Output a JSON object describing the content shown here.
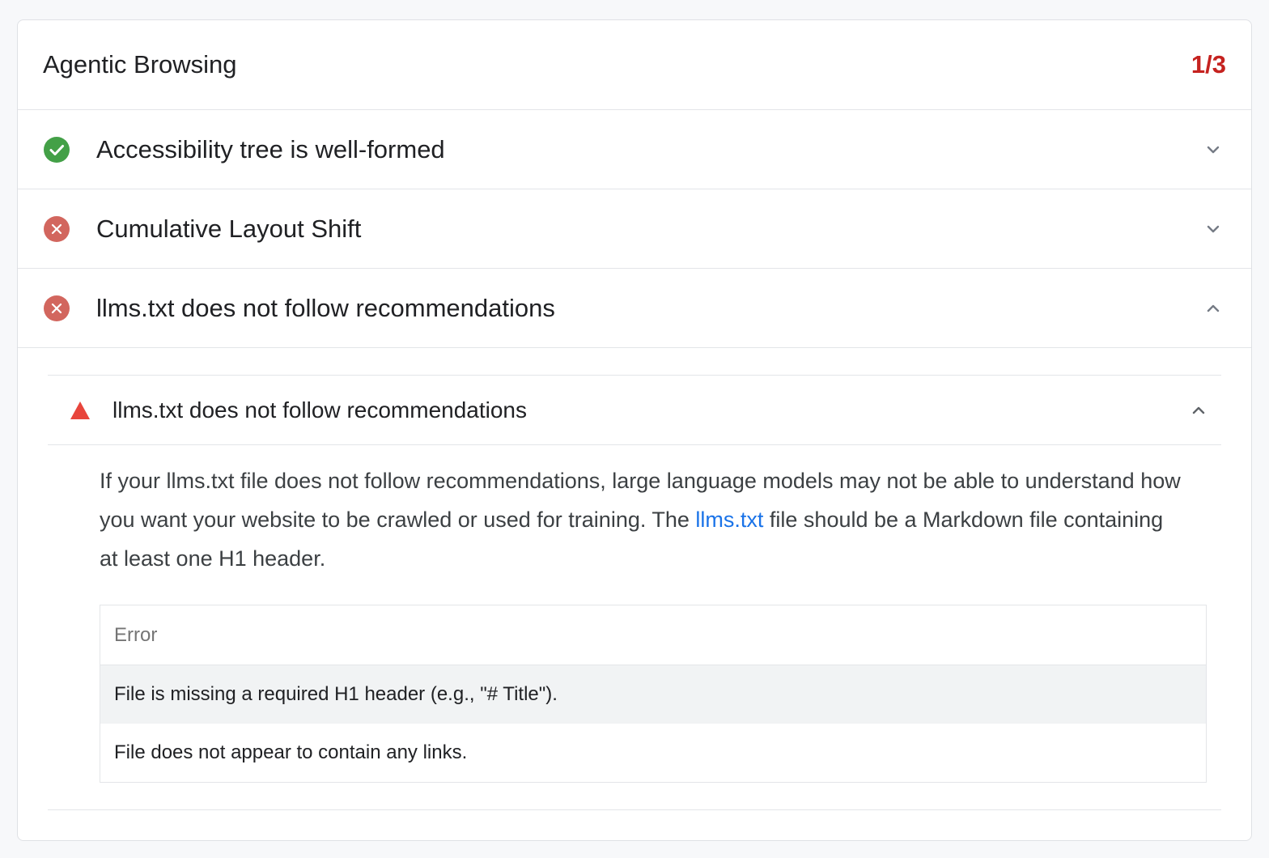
{
  "category": {
    "title": "Agentic Browsing",
    "score": "1/3"
  },
  "audits": [
    {
      "title": "Accessibility tree is well-formed",
      "status": "pass",
      "expanded": false
    },
    {
      "title": "Cumulative Layout Shift",
      "status": "fail",
      "expanded": false
    },
    {
      "title": "llms.txt does not follow recommendations",
      "status": "fail",
      "expanded": true
    }
  ],
  "detail": {
    "title": "llms.txt does not follow recommendations",
    "description_before": "If your llms.txt file does not follow recommendations, large language models may not be able to understand how you want your website to be crawled or used for training. The ",
    "link_text": "llms.txt",
    "description_after": " file should be a Markdown file containing at least one H1 header.",
    "table": {
      "header": "Error",
      "rows": [
        "File is missing a required H1 header (e.g., \"# Title\").",
        "File does not appear to contain any links."
      ]
    }
  },
  "colors": {
    "pass": "#43a047",
    "fail": "#d2665e",
    "warn": "#e8453c",
    "score": "#c5221f",
    "link": "#1a73e8"
  },
  "icons": {
    "pass": "check-circle-icon",
    "fail": "x-circle-icon",
    "warn": "warning-triangle-icon",
    "collapsed": "chevron-down-icon",
    "expanded": "chevron-up-icon"
  }
}
